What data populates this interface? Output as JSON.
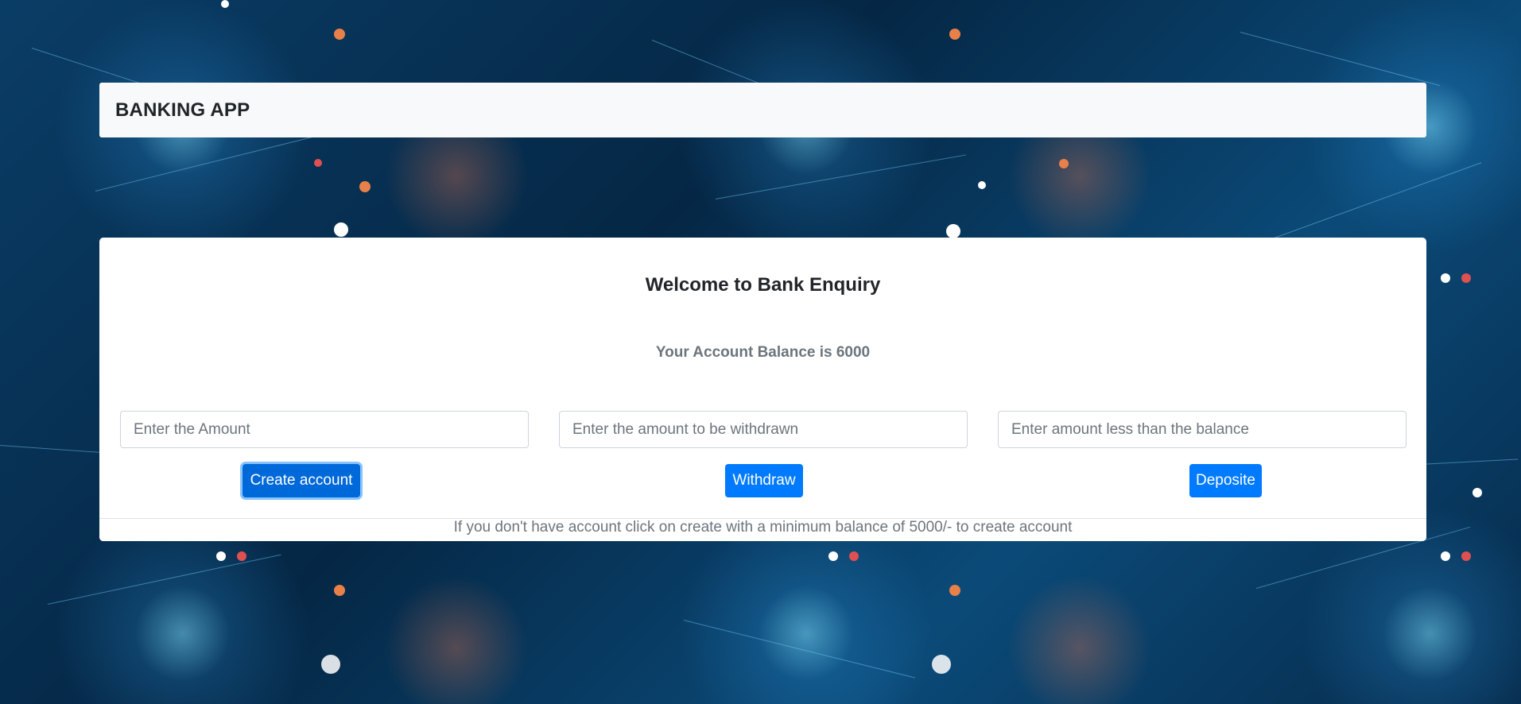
{
  "navbar": {
    "brand": "BANKING APP"
  },
  "main": {
    "title": "Welcome to Bank Enquiry",
    "balance_label": "Your Account Balance is 6000",
    "inputs": {
      "amount_placeholder": "Enter the Amount",
      "withdraw_placeholder": "Enter the amount to be withdrawn",
      "deposit_placeholder": "Enter amount less than the balance"
    },
    "buttons": {
      "create_label": "Create account",
      "withdraw_label": "Withdraw",
      "deposit_label": "Deposite"
    },
    "footer_note": "If you don't have account click on create with a minimum balance of 5000/- to create account"
  },
  "colors": {
    "primary": "#007bff",
    "primary_active": "#0069d9",
    "navbar_bg": "#f8f9fa",
    "muted_text": "#6c757d"
  }
}
